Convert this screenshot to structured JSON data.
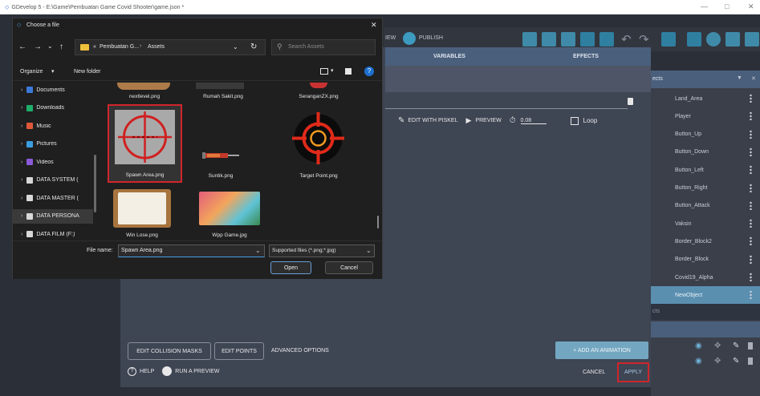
{
  "window": {
    "title": "GDevelop 5 - E:\\Game\\Pembuatan Game Covid Shooter\\game.json *"
  },
  "toolbar": {
    "preview_partial": "IEW",
    "publish_label": "PUBLISH"
  },
  "editor": {
    "tabs": [
      "VARIABLES",
      "EFFECTS"
    ],
    "edit_with_piskel": "EDIT WITH PISKEL",
    "preview": "PREVIEW",
    "frame_time": "0.08",
    "loop": "Loop",
    "edit_collision_masks": "EDIT COLLISION MASKS",
    "edit_points": "EDIT POINTS",
    "advanced_options": "ADVANCED OPTIONS",
    "add_animation": "+ ADD AN ANIMATION",
    "help": "HELP",
    "run_preview": "RUN A PREVIEW",
    "cancel": "CANCEL",
    "apply": "APPLY"
  },
  "objects_panel": {
    "header": "ects",
    "sub_header": "cts",
    "items": [
      "Land_Area",
      "Player",
      "Button_Up",
      "Button_Down",
      "Button_Left",
      "Button_Right",
      "Button_Attack",
      "Vaksin",
      "Border_Block2",
      "Border_Block",
      "Covid19_Alpha",
      "NewObject"
    ]
  },
  "file_dialog": {
    "title": "Choose a file",
    "breadcrumb_prefix": "«",
    "breadcrumb": [
      "Pembuatan G...",
      "Assets"
    ],
    "search_placeholder": "Search Assets",
    "organize": "Organize",
    "new_folder": "New folder",
    "sidebar": [
      "Documents",
      "Downloads",
      "Music",
      "Pictures",
      "Videos",
      "DATA SYSTEM (",
      "DATA MASTER (",
      "DATA PERSONA",
      "DATA FILM (F:)"
    ],
    "files_row1": [
      "nextlevel.png",
      "Rumah Sakit.png",
      "SeranganZX.png"
    ],
    "files_row2": [
      "Spawn Area.png",
      "Suntik.png",
      "Target Point.png"
    ],
    "files_row3": [
      "Win Lose.png",
      "Wpp Game.jpg"
    ],
    "file_name_label": "File name:",
    "file_name_value": "Spawn Area.png",
    "file_type": "Supported files (*.png;*.jpg)",
    "open": "Open",
    "cancel": "Cancel"
  },
  "colors": {
    "accent": "#4a9fc4",
    "highlight": "#d0262b",
    "selected_object": "#5a8fb0"
  }
}
